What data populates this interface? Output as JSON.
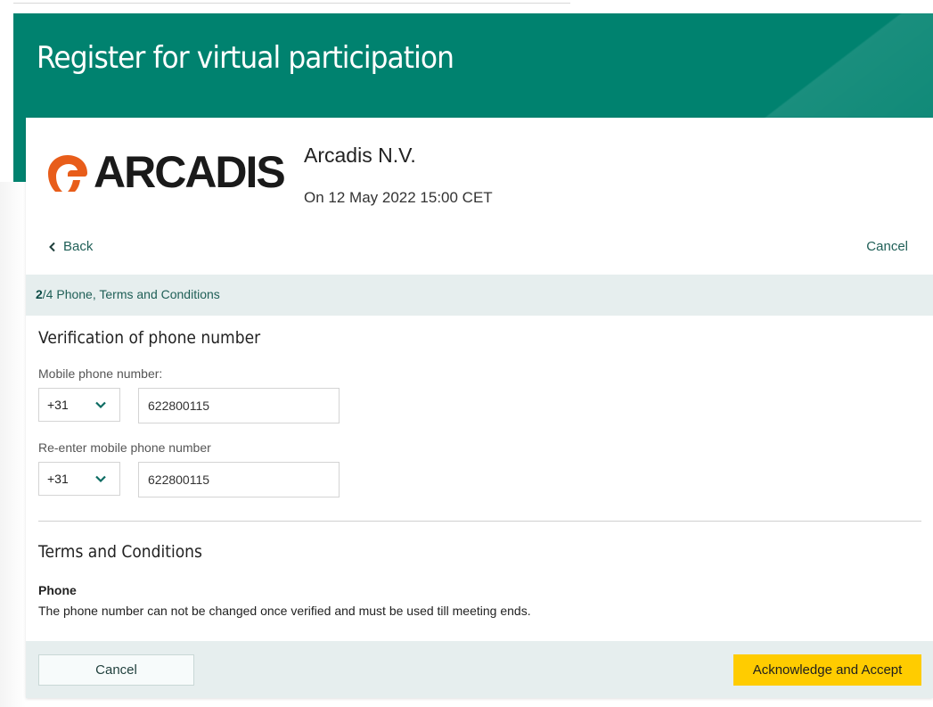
{
  "page": {
    "title": "Register for virtual participation"
  },
  "brand": {
    "logo_text": "ARCADIS",
    "company_name": "Arcadis N.V.",
    "meeting_date": "On 12 May 2022 15:00 CET",
    "colors": {
      "hero": "#00826f",
      "logo_mark": "#e85d1a",
      "accent_button": "#ffcc00",
      "panel": "#e6eeee"
    }
  },
  "nav": {
    "back_label": "Back",
    "back_icon": "chevron-left-icon",
    "cancel_label": "Cancel"
  },
  "step": {
    "current": "2",
    "text": "/4 Phone, Terms and Conditions"
  },
  "verification": {
    "heading": "Verification of phone number",
    "mobile_label": "Mobile phone number:",
    "mobile_country_code": "+31",
    "mobile_value": "622800115",
    "reenter_label": "Re-enter mobile phone number",
    "reenter_country_code": "+31",
    "reenter_value": "622800115",
    "dropdown_icon": "chevron-down-icon"
  },
  "terms": {
    "heading": "Terms and Conditions",
    "item_title": "Phone",
    "item_text": "The phone number can not be changed once verified and must be used till meeting ends."
  },
  "footer": {
    "cancel_label": "Cancel",
    "accept_label": "Acknowledge and Accept"
  }
}
